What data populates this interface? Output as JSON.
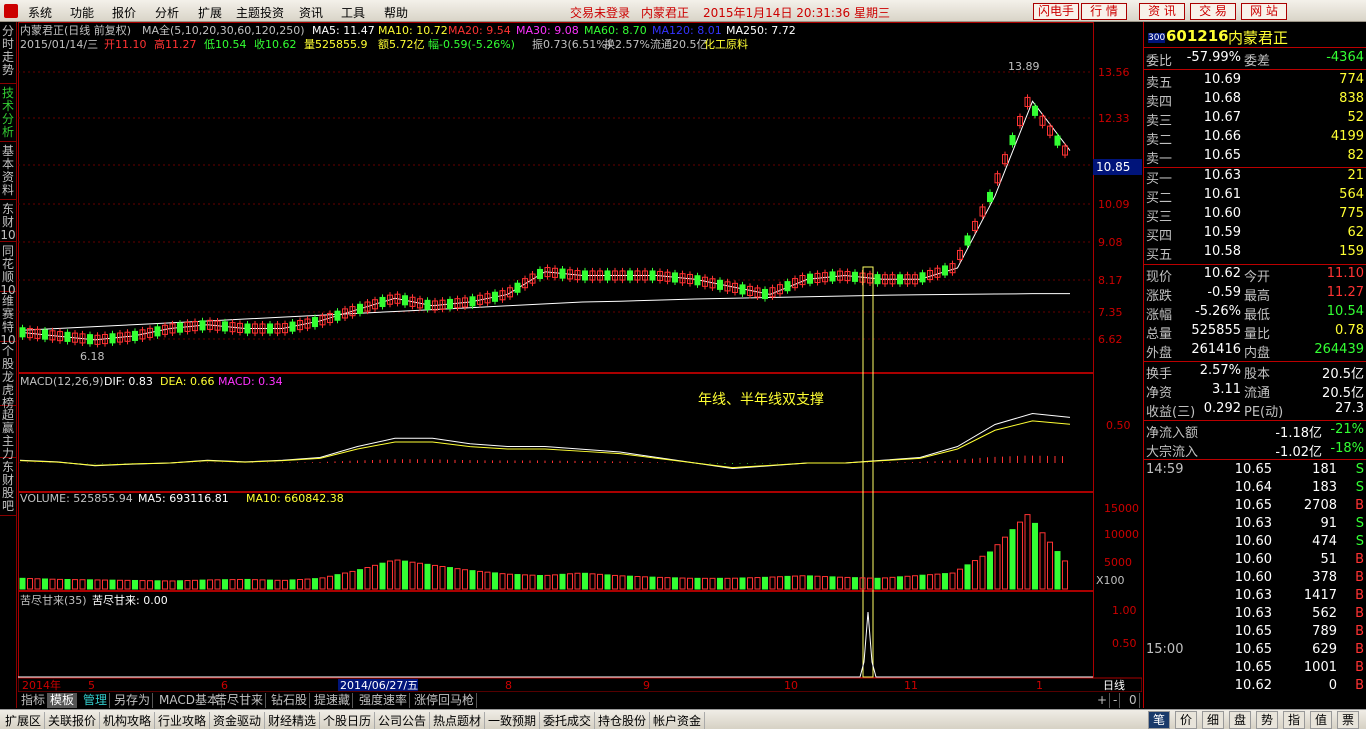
{
  "menu": [
    "系统",
    "功能",
    "报价",
    "分析",
    "扩展",
    "主题投资",
    "资讯",
    "工具",
    "帮助"
  ],
  "status": {
    "login": "交易未登录",
    "stock": "内蒙君正",
    "datetime": "2015年1月14日 20:31:36 星期三"
  },
  "top_buttons": [
    "闪电手",
    "行 情",
    "资 讯",
    "交 易",
    "网 站"
  ],
  "left_tabs": [
    {
      "label": "分时走势",
      "active": false
    },
    {
      "label": "技术分析",
      "active": true
    },
    {
      "label": "基本资料",
      "active": false
    },
    {
      "label": "东财10",
      "active": false
    },
    {
      "label": "同花顺10",
      "active": false
    },
    {
      "label": "维赛特10",
      "active": false
    },
    {
      "label": "个股龙虎榜",
      "active": false
    },
    {
      "label": "超赢主力",
      "active": false
    },
    {
      "label": "东财股吧",
      "active": false
    }
  ],
  "chart_header": {
    "title": "内蒙君正(日线 前复权)",
    "ma_label": "MA全(5,10,20,30,60,120,250)",
    "ma": [
      {
        "t": "MA5: 11.47",
        "c": "#ffffff"
      },
      {
        "t": "MA10: 10.72",
        "c": "#ffff33"
      },
      {
        "t": "MA20: 9.54",
        "c": "#ff3333"
      },
      {
        "t": "MA30: 9.08",
        "c": "#ff33ff"
      },
      {
        "t": "MA60: 8.70",
        "c": "#33ff33"
      },
      {
        "t": "MA120: 8.01",
        "c": "#3333ff"
      },
      {
        "t": "MA250: 7.72",
        "c": "#ffffff"
      }
    ],
    "line2": [
      {
        "t": "2015/01/14/三",
        "c": "#c0c0c0"
      },
      {
        "t": "开11.10",
        "c": "#ff3333"
      },
      {
        "t": "高11.27",
        "c": "#ff3333"
      },
      {
        "t": "低10.54",
        "c": "#33ff33"
      },
      {
        "t": "收10.62",
        "c": "#33ff33"
      },
      {
        "t": "量525855.9",
        "c": "#ffff33"
      },
      {
        "t": "额5.72亿",
        "c": "#ffff33"
      },
      {
        "t": "幅-0.59(-5.26%)",
        "c": "#33ff33"
      },
      {
        "t": "振0.73(6.51%)",
        "c": "#c0c0c0"
      },
      {
        "t": "换2.57%",
        "c": "#c0c0c0"
      },
      {
        "t": "流通20.5亿",
        "c": "#c0c0c0"
      },
      {
        "t": "化工原料",
        "c": "#ffff33"
      }
    ]
  },
  "price_axis": [
    "13.56",
    "12.33",
    "10.09",
    "9.08",
    "8.17",
    "7.35",
    "6.62"
  ],
  "current_price_tag": "10.85",
  "hi_label": "13.89",
  "lo_label": "6.18",
  "macd_header": {
    "name": "MACD(12,26,9)",
    "dif": "DIF: 0.83",
    "dea": "DEA: 0.66",
    "macd": "MACD: 0.34"
  },
  "macd_axis": [
    "0.50"
  ],
  "annotation": "年线、半年线双支撑",
  "vol_header": {
    "name": "VOLUME: 525855.94",
    "ma5": "MA5: 693116.81",
    "ma10": "MA10: 660842.38"
  },
  "vol_axis": [
    "15000",
    "10000",
    "5000"
  ],
  "vol_unit": "X100",
  "ind_header": {
    "name": "苦尽甘来(35)",
    "val": "苦尽甘来: 0.00"
  },
  "ind_axis": [
    "1.00",
    "0.50"
  ],
  "date_axis": {
    "labels": [
      "2014年",
      "5",
      "6",
      "7",
      "8",
      "9",
      "10",
      "11",
      "1"
    ],
    "cursor": "2014/06/27/五",
    "period": "日线"
  },
  "bottom_tabs": [
    "指标",
    "模板",
    "管理",
    "另存为",
    "MACD基本",
    "苦尽甘来",
    "钻石股",
    "提速藏",
    "强度速率",
    "涨停回马枪"
  ],
  "zoom_controls": [
    "+",
    "-",
    "0"
  ],
  "links": [
    "扩展区",
    "关联报价",
    "机构攻略",
    "行业攻略",
    "资金驱动",
    "财经精选",
    "个股日历",
    "公司公告",
    "热点题材",
    "一致预期",
    "委托成交",
    "持仓股份",
    "帐户资金"
  ],
  "right_tabs": [
    "笔",
    "价",
    "细",
    "盘",
    "势",
    "指",
    "值",
    "票"
  ],
  "quote": {
    "code": "601216",
    "name": "内蒙君正",
    "badge": "300",
    "weibi": {
      "label": "委比",
      "value": "-57.99%",
      "label2": "委差",
      "value2": "-4364"
    },
    "sells": [
      {
        "label": "卖五",
        "price": "10.69",
        "vol": "774"
      },
      {
        "label": "卖四",
        "price": "10.68",
        "vol": "838"
      },
      {
        "label": "卖三",
        "price": "10.67",
        "vol": "52"
      },
      {
        "label": "卖二",
        "price": "10.66",
        "vol": "4199"
      },
      {
        "label": "卖一",
        "price": "10.65",
        "vol": "82"
      }
    ],
    "buys": [
      {
        "label": "买一",
        "price": "10.63",
        "vol": "21"
      },
      {
        "label": "买二",
        "price": "10.61",
        "vol": "564"
      },
      {
        "label": "买三",
        "price": "10.60",
        "vol": "775"
      },
      {
        "label": "买四",
        "price": "10.59",
        "vol": "62"
      },
      {
        "label": "买五",
        "price": "10.58",
        "vol": "159"
      }
    ],
    "stats": [
      {
        "l1": "现价",
        "v1": "10.62",
        "c1": "green",
        "l2": "今开",
        "v2": "11.10",
        "c2": "red"
      },
      {
        "l1": "涨跌",
        "v1": "-0.59",
        "c1": "green",
        "l2": "最高",
        "v2": "11.27",
        "c2": "red"
      },
      {
        "l1": "涨幅",
        "v1": "-5.26%",
        "c1": "green",
        "l2": "最低",
        "v2": "10.54",
        "c2": "green"
      },
      {
        "l1": "总量",
        "v1": "525855",
        "c1": "yellow",
        "l2": "量比",
        "v2": "0.78",
        "c2": "yellow"
      },
      {
        "l1": "外盘",
        "v1": "261416",
        "c1": "red",
        "l2": "内盘",
        "v2": "264439",
        "c2": "green"
      }
    ],
    "fund": [
      {
        "l1": "换手",
        "v1": "2.57%",
        "c1": "white",
        "l2": "股本",
        "v2": "20.5亿",
        "c2": "white"
      },
      {
        "l1": "净资",
        "v1": "3.11",
        "c1": "white",
        "l2": "流通",
        "v2": "20.5亿",
        "c2": "white"
      },
      {
        "l1": "收益(三)",
        "v1": "0.292",
        "c1": "white",
        "l2": "PE(动)",
        "v2": "27.3",
        "c2": "white"
      }
    ],
    "flows": [
      {
        "label": "净流入额",
        "v1": "-1.18亿",
        "v2": "-21%"
      },
      {
        "label": "大宗流入",
        "v1": "-1.02亿",
        "v2": "-18%"
      }
    ],
    "ticks": [
      {
        "time": "14:59",
        "price": "10.65",
        "vol": "181",
        "side": "S"
      },
      {
        "time": "",
        "price": "10.64",
        "vol": "183",
        "side": "S"
      },
      {
        "time": "",
        "price": "10.65",
        "vol": "2708",
        "side": "B"
      },
      {
        "time": "",
        "price": "10.63",
        "vol": "91",
        "side": "S"
      },
      {
        "time": "",
        "price": "10.60",
        "vol": "474",
        "side": "S"
      },
      {
        "time": "",
        "price": "10.60",
        "vol": "51",
        "side": "B"
      },
      {
        "time": "",
        "price": "10.60",
        "vol": "378",
        "side": "B"
      },
      {
        "time": "",
        "price": "10.63",
        "vol": "1417",
        "side": "B"
      },
      {
        "time": "",
        "price": "10.63",
        "vol": "562",
        "side": "B"
      },
      {
        "time": "",
        "price": "10.65",
        "vol": "789",
        "side": "B"
      },
      {
        "time": "15:00",
        "price": "10.65",
        "vol": "629",
        "side": "B"
      },
      {
        "time": "",
        "price": "10.65",
        "vol": "1001",
        "side": "B"
      },
      {
        "time": "",
        "price": "10.62",
        "vol": "0",
        "side": "B"
      }
    ]
  },
  "chart_data": {
    "type": "line",
    "series": [
      {
        "name": "MA5",
        "values": [
          6.7,
          6.6,
          6.5,
          6.6,
          6.8,
          6.9,
          6.8,
          6.8,
          7.0,
          7.3,
          7.6,
          7.4,
          7.5,
          7.7,
          8.3,
          8.2,
          8.2,
          8.2,
          8.1,
          7.9,
          7.7,
          8.1,
          8.2,
          8.1,
          8.1,
          8.4,
          10.3,
          12.8,
          11.5
        ]
      },
      {
        "name": "MA250",
        "values": [
          6.75,
          6.8,
          6.85,
          6.9,
          6.95,
          7.0,
          7.05,
          7.1,
          7.15,
          7.2,
          7.25,
          7.3,
          7.35,
          7.4,
          7.45,
          7.5,
          7.52,
          7.55,
          7.58,
          7.6,
          7.62,
          7.64,
          7.66,
          7.68,
          7.69,
          7.7,
          7.71,
          7.72,
          7.72
        ]
      }
    ],
    "macd": {
      "dif": [
        0.05,
        0.02,
        -0.05,
        -0.02,
        0.0,
        0.05,
        0.02,
        0.05,
        0.1,
        0.3,
        0.45,
        0.45,
        0.35,
        0.3,
        0.3,
        0.25,
        0.2,
        0.1,
        0.0,
        -0.1,
        -0.05,
        0.0,
        0.0,
        0.05,
        0.1,
        0.3,
        0.7,
        0.9,
        0.83
      ]
    },
    "volume": {
      "values": [
        2000,
        1800,
        1700,
        1600,
        1500,
        1700,
        1800,
        1600,
        2000,
        3500,
        5500,
        4500,
        3500,
        2800,
        2500,
        3000,
        2500,
        2200,
        2000,
        2000,
        2200,
        2500,
        2200,
        2000,
        2500,
        3000,
        7000,
        14000,
        5258
      ]
    },
    "yrange": [
      6.18,
      13.89
    ]
  }
}
